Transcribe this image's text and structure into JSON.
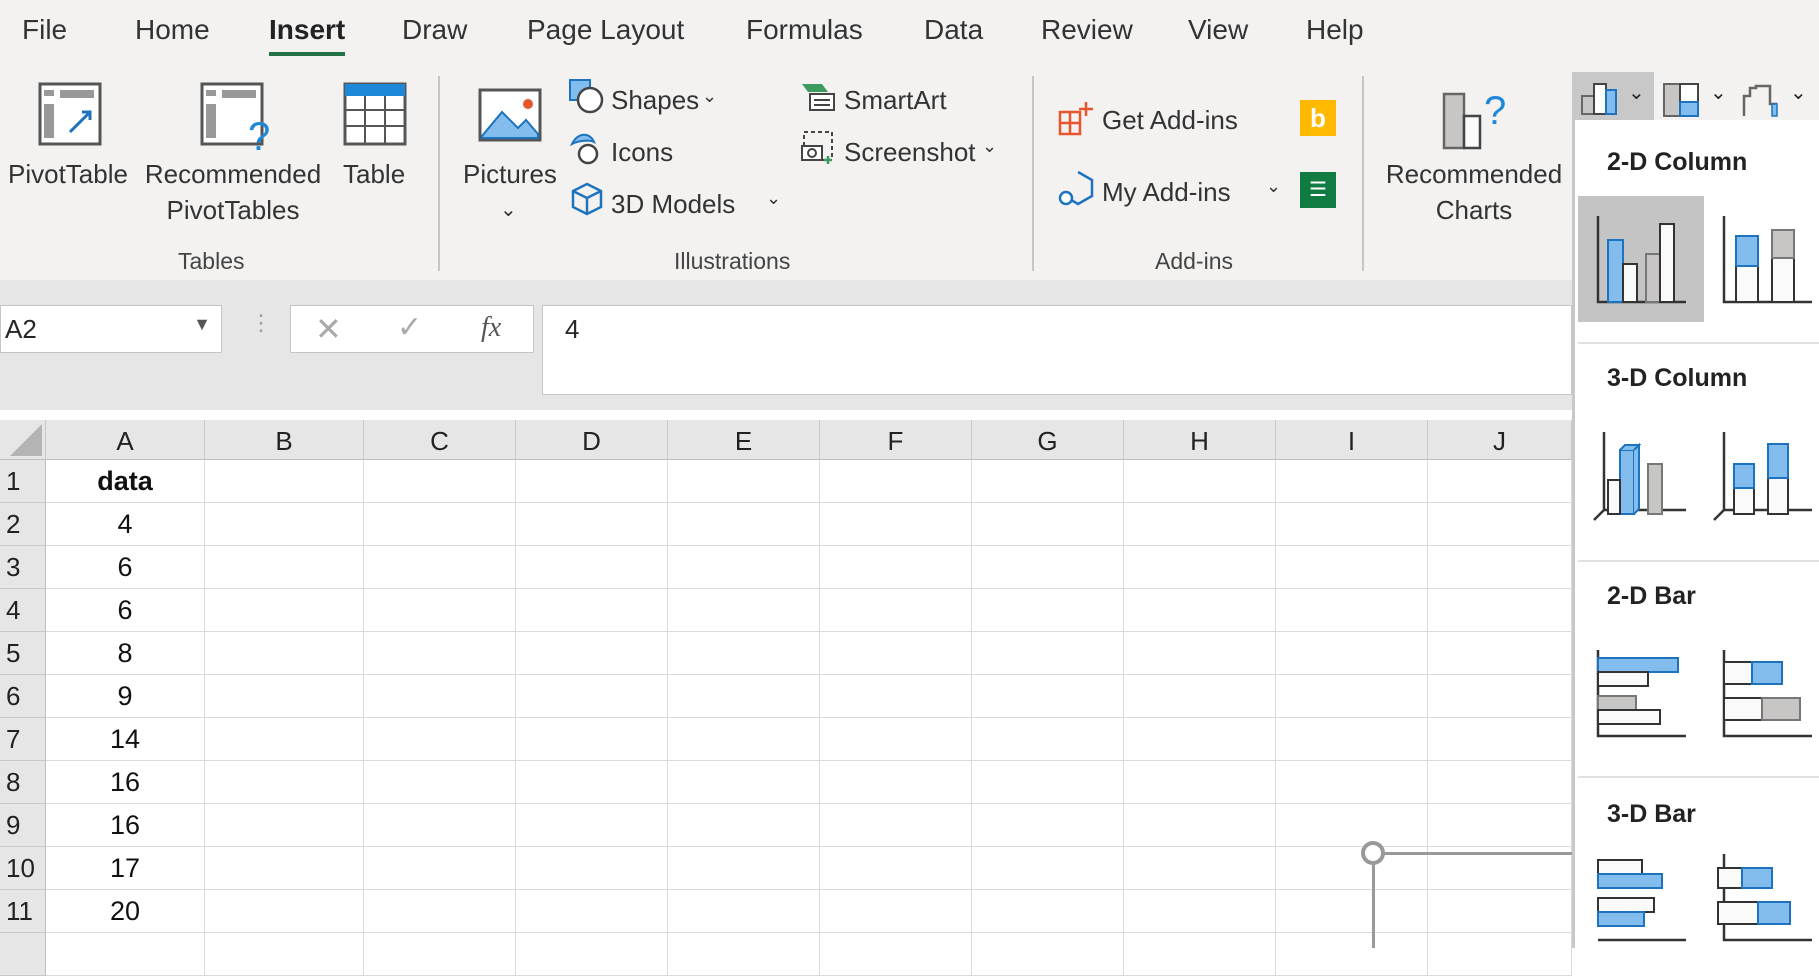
{
  "menu": {
    "tabs": [
      "File",
      "Home",
      "Insert",
      "Draw",
      "Page Layout",
      "Formulas",
      "Data",
      "Review",
      "View",
      "Help"
    ],
    "active": "Insert"
  },
  "ribbon": {
    "tables": {
      "group": "Tables",
      "pivottable": "PivotTable",
      "recommended1": "Recommended",
      "recommended2": "PivotTables",
      "table": "Table"
    },
    "illustrations": {
      "group": "Illustrations",
      "pictures": "Pictures",
      "shapes": "Shapes",
      "icons": "Icons",
      "models": "3D Models",
      "smartart": "SmartArt",
      "screenshot": "Screenshot"
    },
    "addins": {
      "group": "Add-ins",
      "get": "Get Add-ins",
      "my": "My Add-ins"
    },
    "charts": {
      "rec1": "Recommended",
      "rec2": "Charts"
    }
  },
  "formula_bar": {
    "name_box": "A2",
    "fx": "fx",
    "value": "4"
  },
  "sheet": {
    "columns": [
      "A",
      "B",
      "C",
      "D",
      "E",
      "F",
      "G",
      "H",
      "I",
      "J"
    ],
    "rows": [
      "1",
      "2",
      "3",
      "4",
      "5",
      "6",
      "7",
      "8",
      "9",
      "10",
      "11"
    ],
    "column_a": [
      "data",
      "4",
      "6",
      "6",
      "8",
      "9",
      "14",
      "16",
      "16",
      "17",
      "20"
    ]
  },
  "chart_dropdown": {
    "sections": [
      "2-D Column",
      "3-D Column",
      "2-D Bar",
      "3-D Bar"
    ]
  },
  "colors": {
    "accent": "#217346",
    "chart_blue": "#83bded"
  }
}
